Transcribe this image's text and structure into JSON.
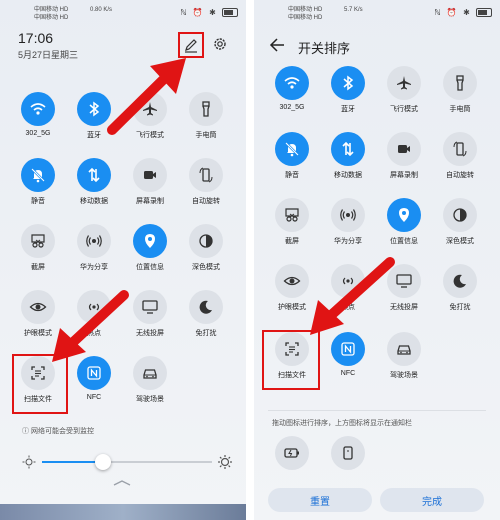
{
  "colors": {
    "accent": "#1a8ef2",
    "highlight": "#e01414",
    "tile_off": "#dde1e7"
  },
  "left": {
    "status": {
      "carrier_line1": "中国移动 HD",
      "carrier_line2": "中国移动 HD",
      "net": "0.80 K/s"
    },
    "time": "17:06",
    "date": "5月27日星期三",
    "tiles": [
      {
        "label": "302_5G",
        "icon": "wifi-icon",
        "on": true
      },
      {
        "label": "蓝牙",
        "icon": "bluetooth-icon",
        "on": true
      },
      {
        "label": "飞行模式",
        "icon": "airplane-icon",
        "on": false
      },
      {
        "label": "手电筒",
        "icon": "flashlight-icon",
        "on": false
      },
      {
        "label": "静音",
        "icon": "mute-bell-icon",
        "on": true
      },
      {
        "label": "移动数据",
        "icon": "mobile-data-icon",
        "on": true
      },
      {
        "label": "屏幕录制",
        "icon": "screen-record-icon",
        "on": false
      },
      {
        "label": "自动旋转",
        "icon": "auto-rotate-icon",
        "on": false
      },
      {
        "label": "截屏",
        "icon": "screenshot-icon",
        "on": false
      },
      {
        "label": "华为分享",
        "icon": "huawei-share-icon",
        "on": false
      },
      {
        "label": "位置信息",
        "icon": "location-icon",
        "on": true
      },
      {
        "label": "深色模式",
        "icon": "dark-mode-icon",
        "on": false
      },
      {
        "label": "护眼模式",
        "icon": "eye-comfort-icon",
        "on": false
      },
      {
        "label": "热点",
        "icon": "hotspot-icon",
        "on": false
      },
      {
        "label": "无线投屏",
        "icon": "wireless-projection-icon",
        "on": false
      },
      {
        "label": "免打扰",
        "icon": "do-not-disturb-icon",
        "on": false
      },
      {
        "label": "扫描文件",
        "icon": "scan-document-icon",
        "on": false
      },
      {
        "label": "NFC",
        "icon": "nfc-icon",
        "on": true
      },
      {
        "label": "驾驶场景",
        "icon": "driving-icon",
        "on": false
      }
    ],
    "network_warning": "网络可能会受到监控",
    "brightness_level": 0.36
  },
  "right": {
    "status": {
      "carrier_line1": "中国移动 HD",
      "carrier_line2": "中国移动 HD",
      "net": "5.7 K/s"
    },
    "title": "开关排序",
    "tiles": [
      {
        "label": "302_5G",
        "icon": "wifi-icon",
        "on": true
      },
      {
        "label": "蓝牙",
        "icon": "bluetooth-icon",
        "on": true
      },
      {
        "label": "飞行模式",
        "icon": "airplane-icon",
        "on": false
      },
      {
        "label": "手电筒",
        "icon": "flashlight-icon",
        "on": false
      },
      {
        "label": "静音",
        "icon": "mute-bell-icon",
        "on": true
      },
      {
        "label": "移动数据",
        "icon": "mobile-data-icon",
        "on": true
      },
      {
        "label": "屏幕录制",
        "icon": "screen-record-icon",
        "on": false
      },
      {
        "label": "自动旋转",
        "icon": "auto-rotate-icon",
        "on": false
      },
      {
        "label": "截屏",
        "icon": "screenshot-icon",
        "on": false
      },
      {
        "label": "华为分享",
        "icon": "huawei-share-icon",
        "on": false
      },
      {
        "label": "位置信息",
        "icon": "location-icon",
        "on": true
      },
      {
        "label": "深色模式",
        "icon": "dark-mode-icon",
        "on": false
      },
      {
        "label": "护眼模式",
        "icon": "eye-comfort-icon",
        "on": false
      },
      {
        "label": "热点",
        "icon": "hotspot-icon",
        "on": false
      },
      {
        "label": "无线投屏",
        "icon": "wireless-projection-icon",
        "on": false
      },
      {
        "label": "免打扰",
        "icon": "do-not-disturb-icon",
        "on": false
      },
      {
        "label": "扫描文件",
        "icon": "scan-document-icon",
        "on": false
      },
      {
        "label": "NFC",
        "icon": "nfc-icon",
        "on": true
      },
      {
        "label": "驾驶场景",
        "icon": "driving-icon",
        "on": false
      }
    ],
    "hint": "拖动图标进行排序，上方图标将显示在通知栏",
    "extra_tiles": [
      {
        "icon": "battery-saver-icon"
      },
      {
        "icon": "phone-clone-icon"
      }
    ],
    "reset_label": "重置",
    "done_label": "完成"
  }
}
